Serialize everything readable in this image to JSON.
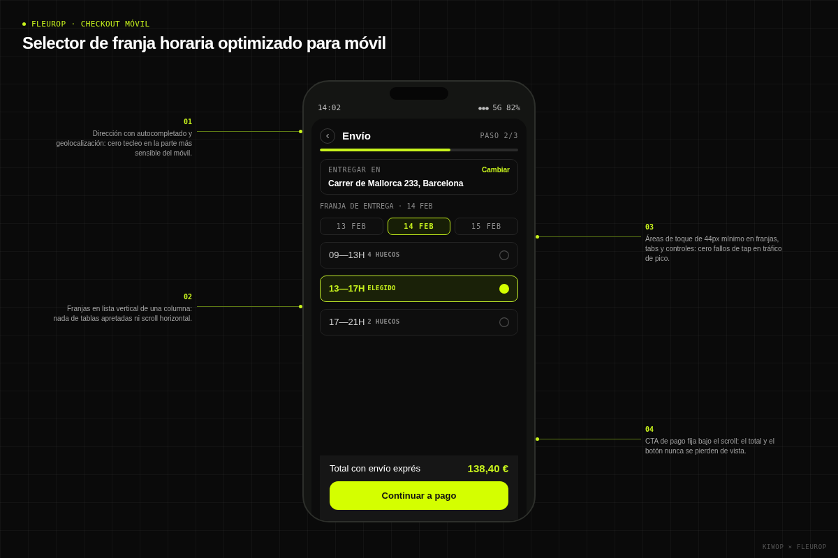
{
  "header": {
    "eyebrow": "FLEUROP · CHECKOUT MÓVIL",
    "title": "Selector de franja horaria optimizado para móvil"
  },
  "callouts": {
    "left": [
      {
        "number": "01",
        "text": "Dirección con autocompletado y geolocalización: cero tecleo en la parte más sensible del móvil."
      },
      {
        "number": "02",
        "text": "Franjas en lista vertical de una columna: nada de tablas apretadas ni scroll horizontal."
      }
    ],
    "right": [
      {
        "number": "03",
        "text": "Áreas de toque de 44px mínimo en franjas, tabs y controles: cero fallos de tap en tráfico de pico."
      },
      {
        "number": "04",
        "text": "CTA de pago fija bajo el scroll: el total y el botón nunca se pierden de vista."
      }
    ]
  },
  "phone": {
    "status_bar": {
      "time": "14:02",
      "network": "5G 82%"
    },
    "screen": {
      "title": "Envío",
      "step": "PASO 2/3",
      "progress": {
        "level": 0.66
      },
      "address": {
        "label": "ENTREGAR EN",
        "action": "Cambiar",
        "value": "Carrer de Mallorca 233, Barcelona"
      },
      "section_label": "FRANJA DE ENTREGA · 14 FEB",
      "date_tabs": [
        {
          "label": "13 FEB",
          "selected": false
        },
        {
          "label": "14 FEB",
          "selected": true
        },
        {
          "label": "15 FEB",
          "selected": false
        }
      ],
      "slots": [
        {
          "time": "09—13H",
          "note": "4 HUECOS",
          "selected": false
        },
        {
          "time": "13—17H",
          "note": "ELEGIDO",
          "selected": true
        },
        {
          "time": "17—21H",
          "note": "2 HUECOS",
          "selected": false
        }
      ],
      "footer": {
        "total_label": "Total con envío exprés",
        "total": "138,40 €",
        "button": "Continuar a pago"
      }
    }
  },
  "credit": "KIWOP × FLEUROP"
}
